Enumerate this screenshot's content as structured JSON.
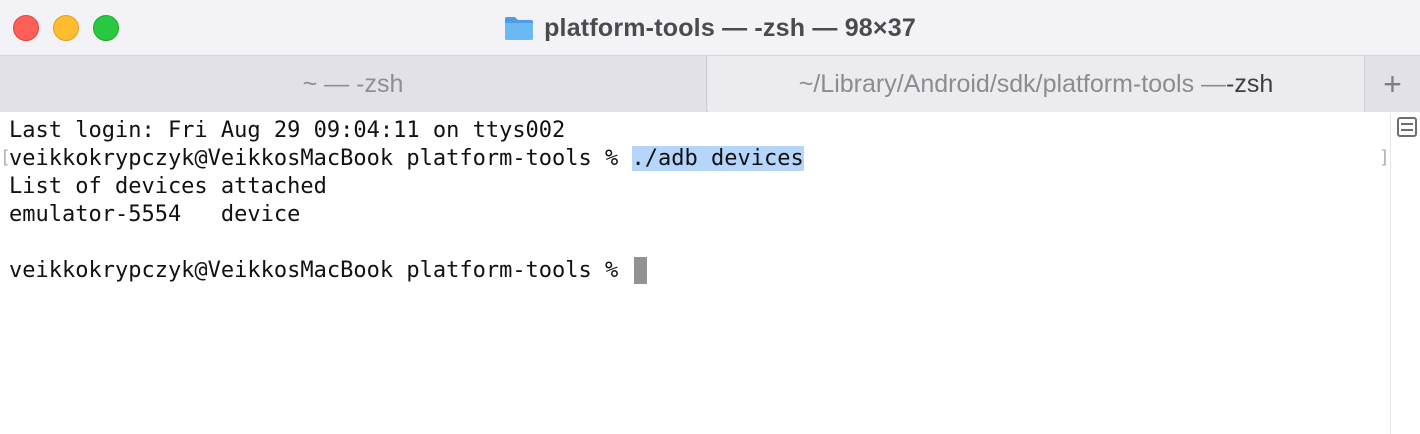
{
  "window": {
    "title": "platform-tools — -zsh — 98×37"
  },
  "tabs": [
    {
      "label": "~ — -zsh",
      "active": false
    },
    {
      "path": "~/Library/Android/sdk/platform-tools — ",
      "shell": "-zsh",
      "active": true
    }
  ],
  "new_tab": {
    "label": "+"
  },
  "terminal": {
    "lines": [
      "Last login: Fri Aug 29 09:04:11 on ttys002",
      "veikkokrypczyk@VeikkosMacBook platform-tools % ",
      "List of devices attached",
      "emulator-5554   device",
      "veikkokrypczyk@VeikkosMacBook platform-tools % "
    ],
    "selected_command": "./adb devices",
    "left_bracket": "[",
    "right_bracket": "]"
  },
  "colors": {
    "selection": "#b5d5fb",
    "close": "#fe5f57",
    "minimize": "#febc2e",
    "zoom": "#28c840",
    "folder": "#5aa9e6"
  },
  "icons": {
    "folder": "folder-icon",
    "split": "split-pane-icon"
  }
}
